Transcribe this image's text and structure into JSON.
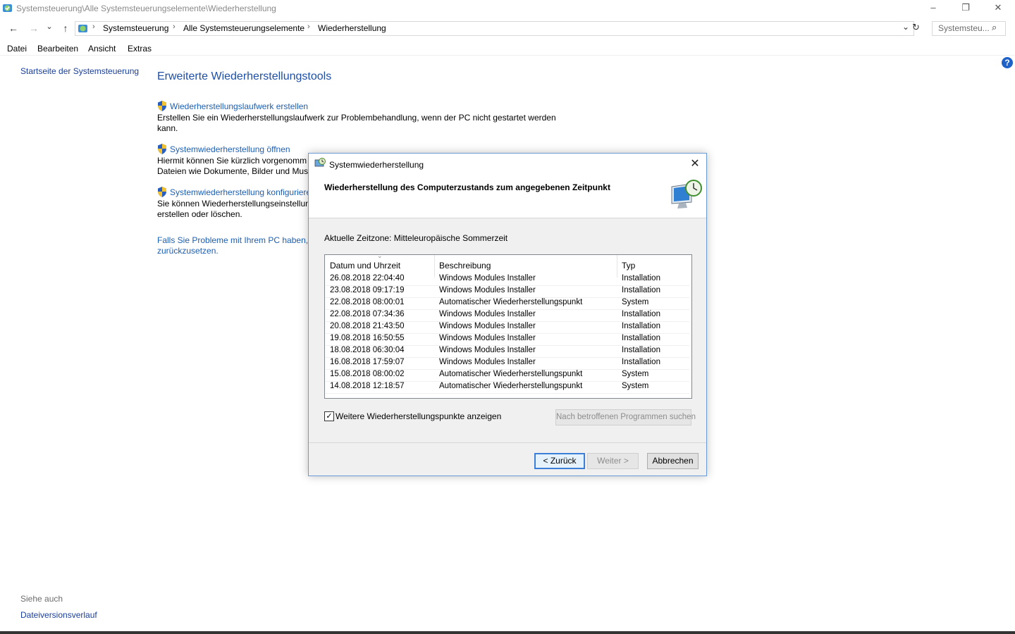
{
  "window": {
    "title": "Systemsteuerung\\Alle Systemsteuerungselemente\\Wiederherstellung",
    "minimize": "–",
    "restore": "❐",
    "close": "✕"
  },
  "address": {
    "back": "←",
    "forward": "→",
    "recent": "⌄",
    "up": "↑",
    "crumbs": [
      "Systemsteuerung",
      "Alle Systemsteuerungselemente",
      "Wiederherstellung"
    ],
    "separator": "›",
    "dropdown": "⌄",
    "refresh": "↻",
    "search_placeholder": "Systemsteu...",
    "search_icon": "⌕"
  },
  "menu": [
    "Datei",
    "Bearbeiten",
    "Ansicht",
    "Extras"
  ],
  "left": {
    "home": "Startseite der Systemsteuerung",
    "see_also": "Siehe auch",
    "file_history": "Dateiversionsverlauf"
  },
  "main": {
    "heading": "Erweiterte Wiederherstellungstools",
    "help_icon": "?",
    "items": [
      {
        "link": "Wiederherstellungslaufwerk erstellen",
        "desc1": "Erstellen Sie ein Wiederherstellungslaufwerk zur Problembehandlung, wenn der PC nicht gestartet werden",
        "desc2": "kann."
      },
      {
        "link": "Systemwiederherstellung öffnen",
        "desc1": "Hiermit können Sie kürzlich vorgenomm",
        "desc2": "Dateien wie Dokumente, Bilder und Musi"
      },
      {
        "link": "Systemwiederherstellung konfigurieren",
        "desc1": "Sie können Wiederherstellungseinstellun",
        "desc2": "erstellen oder löschen."
      }
    ],
    "problem1": "Falls Sie Probleme mit Ihrem PC haben, w",
    "problem2": "zurückzusetzen."
  },
  "dialog": {
    "title": "Systemwiederherstellung",
    "close": "✕",
    "heading": "Wiederherstellung des Computerzustands zum angegebenen Zeitpunkt",
    "timezone": "Aktuelle Zeitzone: Mitteleuropäische Sommerzeit",
    "columns": [
      "Datum und Uhrzeit",
      "Beschreibung",
      "Typ"
    ],
    "sort_indicator": "⌄",
    "rows": [
      [
        "26.08.2018 22:04:40",
        "Windows Modules Installer",
        "Installation"
      ],
      [
        "23.08.2018 09:17:19",
        "Windows Modules Installer",
        "Installation"
      ],
      [
        "22.08.2018 08:00:01",
        "Automatischer Wiederherstellungspunkt",
        "System"
      ],
      [
        "22.08.2018 07:34:36",
        "Windows Modules Installer",
        "Installation"
      ],
      [
        "20.08.2018 21:43:50",
        "Windows Modules Installer",
        "Installation"
      ],
      [
        "19.08.2018 16:50:55",
        "Windows Modules Installer",
        "Installation"
      ],
      [
        "18.08.2018 06:30:04",
        "Windows Modules Installer",
        "Installation"
      ],
      [
        "16.08.2018 17:59:07",
        "Windows Modules Installer",
        "Installation"
      ],
      [
        "15.08.2018 08:00:02",
        "Automatischer Wiederherstellungspunkt",
        "System"
      ],
      [
        "14.08.2018 12:18:57",
        "Automatischer Wiederherstellungspunkt",
        "System"
      ]
    ],
    "checkbox_mark": "✓",
    "checkbox_label": "Weitere Wiederherstellungspunkte anzeigen",
    "scan_button": "Nach betroffenen Programmen suchen",
    "back_button": "< Zurück",
    "next_button": "Weiter >",
    "cancel_button": "Abbrechen"
  }
}
